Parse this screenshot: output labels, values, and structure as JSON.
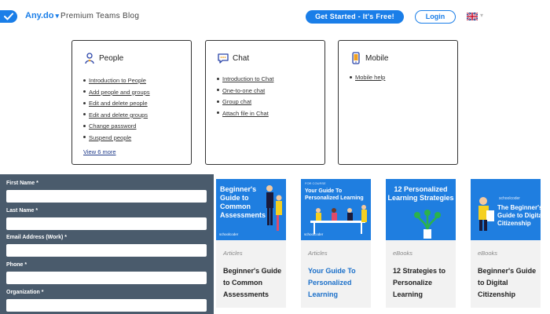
{
  "header": {
    "brand": "Any.do",
    "blog_title": "Premium Teams Blog",
    "get_started": "Get Started - It's Free!",
    "login": "Login"
  },
  "cards": {
    "people": {
      "title": "People",
      "links": [
        "Introduction to People",
        "Add people and groups",
        "Edit and delete people",
        "Edit and delete groups",
        "Change password",
        "Suspend people"
      ],
      "view_more": "View 6 more"
    },
    "chat": {
      "title": "Chat",
      "links": [
        "Introduction to Chat",
        "One-to-one chat",
        "Group chat",
        "Attach file in Chat"
      ]
    },
    "mobile": {
      "title": "Mobile",
      "links": [
        "Mobile help"
      ]
    }
  },
  "form": {
    "fields": [
      "First Name *",
      "Last Name *",
      "Email Address (Work) *",
      "Phone *",
      "Organization *"
    ]
  },
  "articles": [
    {
      "image_text": "Beginner's Guide to Common Assessments",
      "image_logo": "schoolcoder",
      "category": "Articles",
      "title": "Beginner's Guide to Common Assessments"
    },
    {
      "image_small": "FOR COURSE",
      "image_text": "Your Guide To Personalized Learning",
      "image_logo": "schoolcoder",
      "category": "Articles",
      "title": "Your Guide To Personalized Learning"
    },
    {
      "image_text": "12 Personalized Learning Strategies",
      "category": "eBooks",
      "title": "12 Strategies to Personalize Learning"
    },
    {
      "image_small": "schoolcoder",
      "image_text": "The Beginner's Guide to Digital Citizenship",
      "category": "eBooks",
      "title": "Beginner's Guide to Digital Citizenship"
    }
  ],
  "colors": {
    "brand_blue": "#1a7ee8",
    "form_bg": "#4a5b6c",
    "article_bg": "#f2f2f2"
  }
}
